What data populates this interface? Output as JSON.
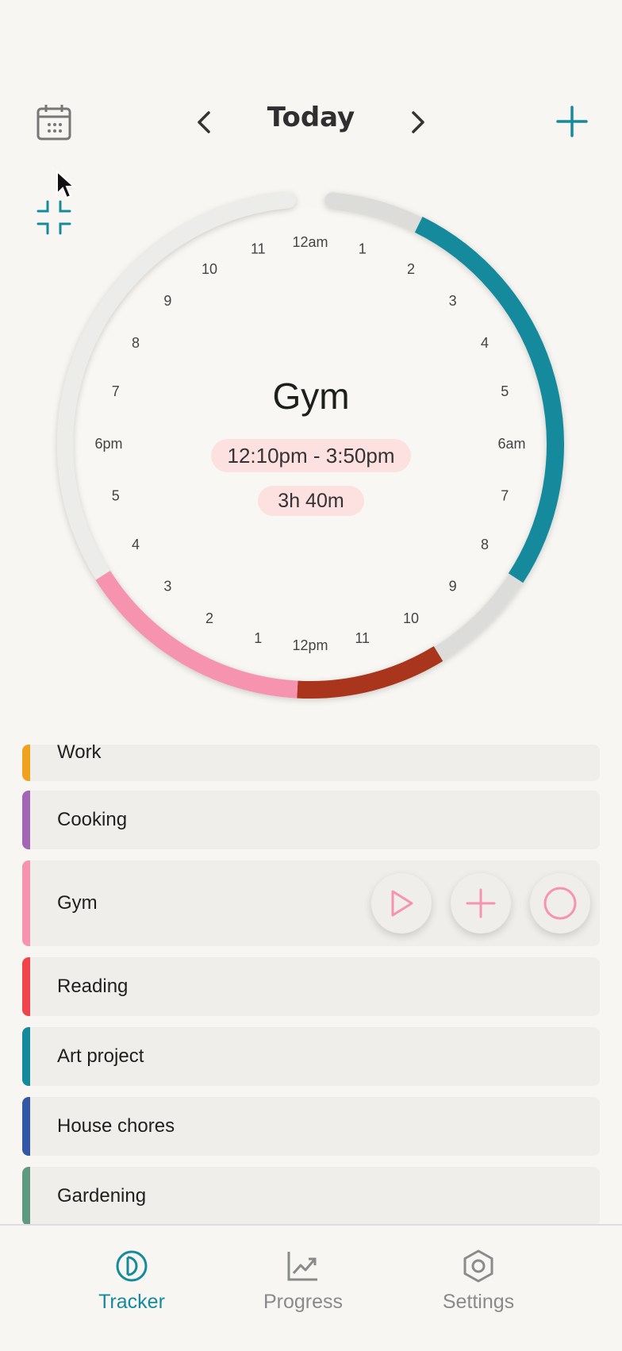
{
  "header": {
    "title": "Today"
  },
  "dial": {
    "hours": [
      "12am",
      "1",
      "2",
      "3",
      "4",
      "5",
      "6am",
      "7",
      "8",
      "9",
      "10",
      "11",
      "12pm",
      "1",
      "2",
      "3",
      "4",
      "5",
      "6pm",
      "7",
      "8",
      "9",
      "10",
      "11"
    ],
    "selected_activity": "Gym",
    "time_range": "12:10pm  - 3:50pm",
    "duration": "3h 40m"
  },
  "activities": [
    {
      "name": "Work",
      "color": "#f0a21f"
    },
    {
      "name": "Cooking",
      "color": "#a366b5"
    },
    {
      "name": "Gym",
      "color": "#f694b0"
    },
    {
      "name": "Reading",
      "color": "#f0434c"
    },
    {
      "name": "Art project",
      "color": "#168a9d"
    },
    {
      "name": "House chores",
      "color": "#3257a6"
    },
    {
      "name": "Gardening",
      "color": "#5e9a80"
    }
  ],
  "nav": {
    "tracker": "Tracker",
    "progress": "Progress",
    "settings": "Settings"
  },
  "colors": {
    "accent": "#168a9d",
    "gym_pink": "#f694b0",
    "segment_red": "#a8351e",
    "pill_bg": "#fde0e0"
  }
}
